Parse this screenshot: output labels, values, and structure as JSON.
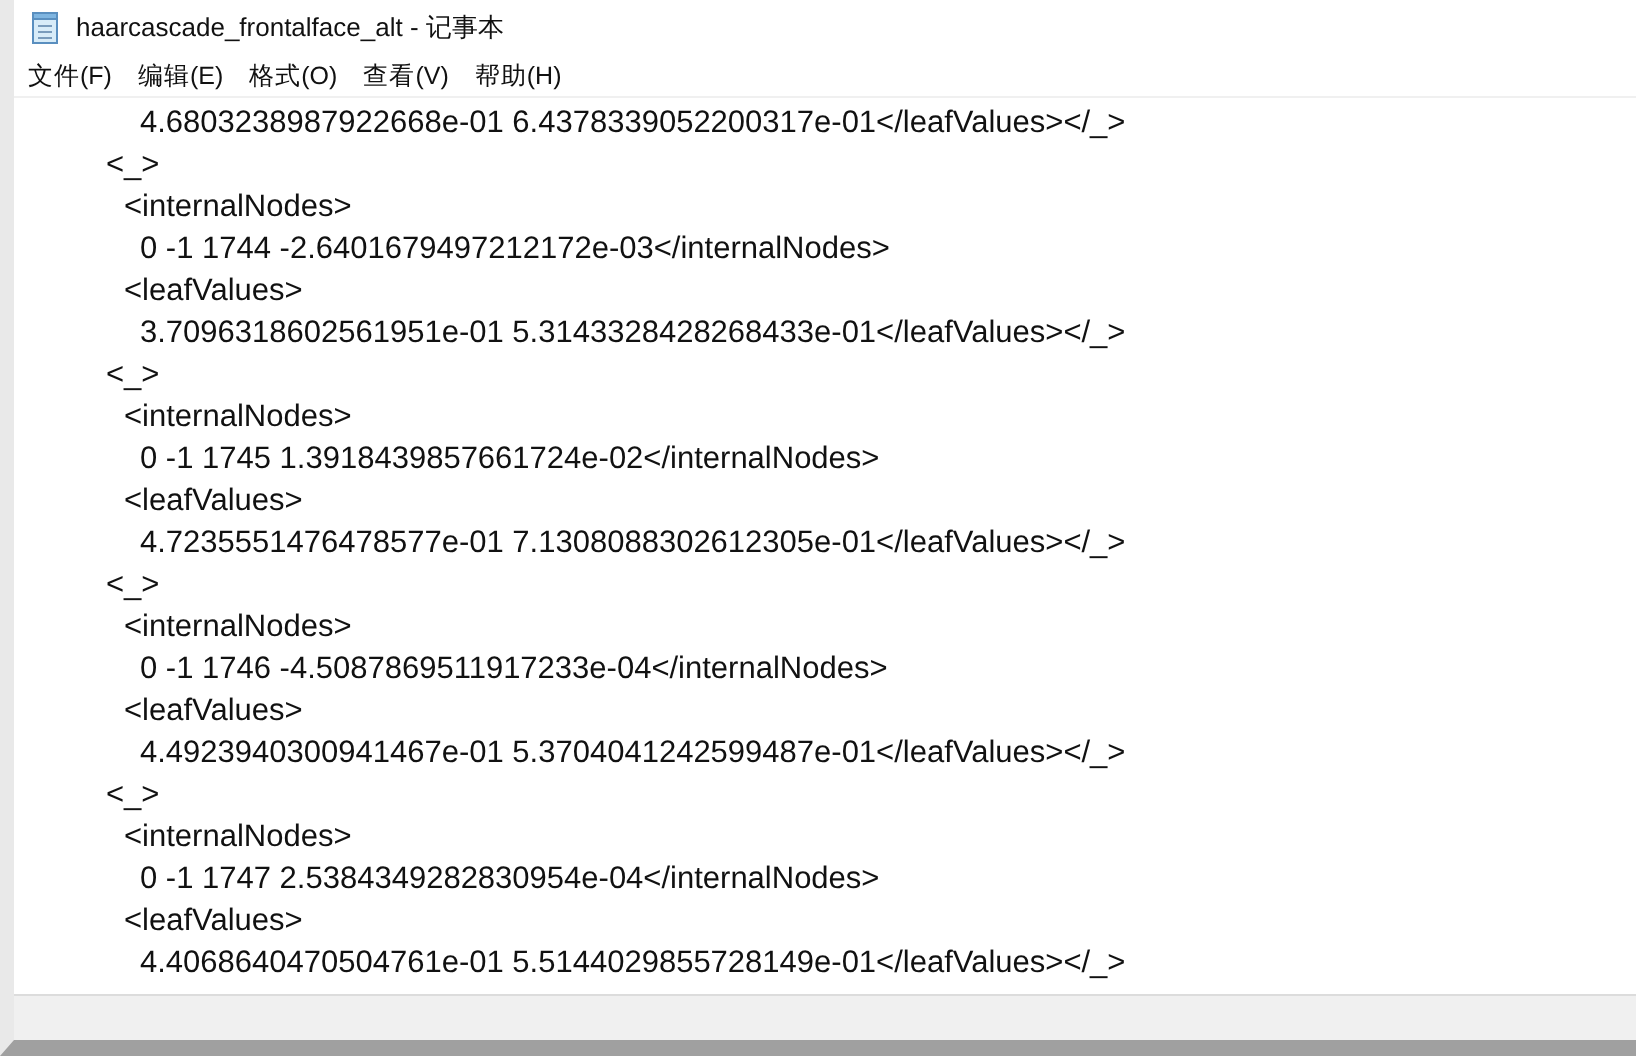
{
  "window": {
    "title": "haarcascade_frontalface_alt - 记事本"
  },
  "menu": [
    "文件(F)",
    "编辑(E)",
    "格式(O)",
    "查看(V)",
    "帮助(H)"
  ],
  "lines": [
    {
      "kind": "data",
      "text": "4.6803238987922668e-01 6.4378339052200317e-01</leafValues></_>"
    },
    {
      "kind": "node",
      "text": "<_>"
    },
    {
      "kind": "tag",
      "text": "<internalNodes>"
    },
    {
      "kind": "data",
      "text": "0 -1 1744 -2.6401679497212172e-03</internalNodes>"
    },
    {
      "kind": "tag",
      "text": "<leafValues>"
    },
    {
      "kind": "data",
      "text": "3.7096318602561951e-01 5.3143328428268433e-01</leafValues></_>"
    },
    {
      "kind": "node",
      "text": "<_>"
    },
    {
      "kind": "tag",
      "text": "<internalNodes>"
    },
    {
      "kind": "data",
      "text": "0 -1 1745 1.3918439857661724e-02</internalNodes>"
    },
    {
      "kind": "tag",
      "text": "<leafValues>"
    },
    {
      "kind": "data",
      "text": "4.7235551476478577e-01 7.1308088302612305e-01</leafValues></_>"
    },
    {
      "kind": "node",
      "text": "<_>"
    },
    {
      "kind": "tag",
      "text": "<internalNodes>"
    },
    {
      "kind": "data",
      "text": "0 -1 1746 -4.5087869511917233e-04</internalNodes>"
    },
    {
      "kind": "tag",
      "text": "<leafValues>"
    },
    {
      "kind": "data",
      "text": "4.4923940300941467e-01 5.3704041242599487e-01</leafValues></_>"
    },
    {
      "kind": "node",
      "text": "<_>"
    },
    {
      "kind": "tag",
      "text": "<internalNodes>"
    },
    {
      "kind": "data",
      "text": "0 -1 1747 2.5384349282830954e-04</internalNodes>"
    },
    {
      "kind": "tag",
      "text": "<leafValues>"
    },
    {
      "kind": "data",
      "text": "4.4068640470504761e-01 5.5144029855728149e-01</leafValues></_>"
    }
  ]
}
